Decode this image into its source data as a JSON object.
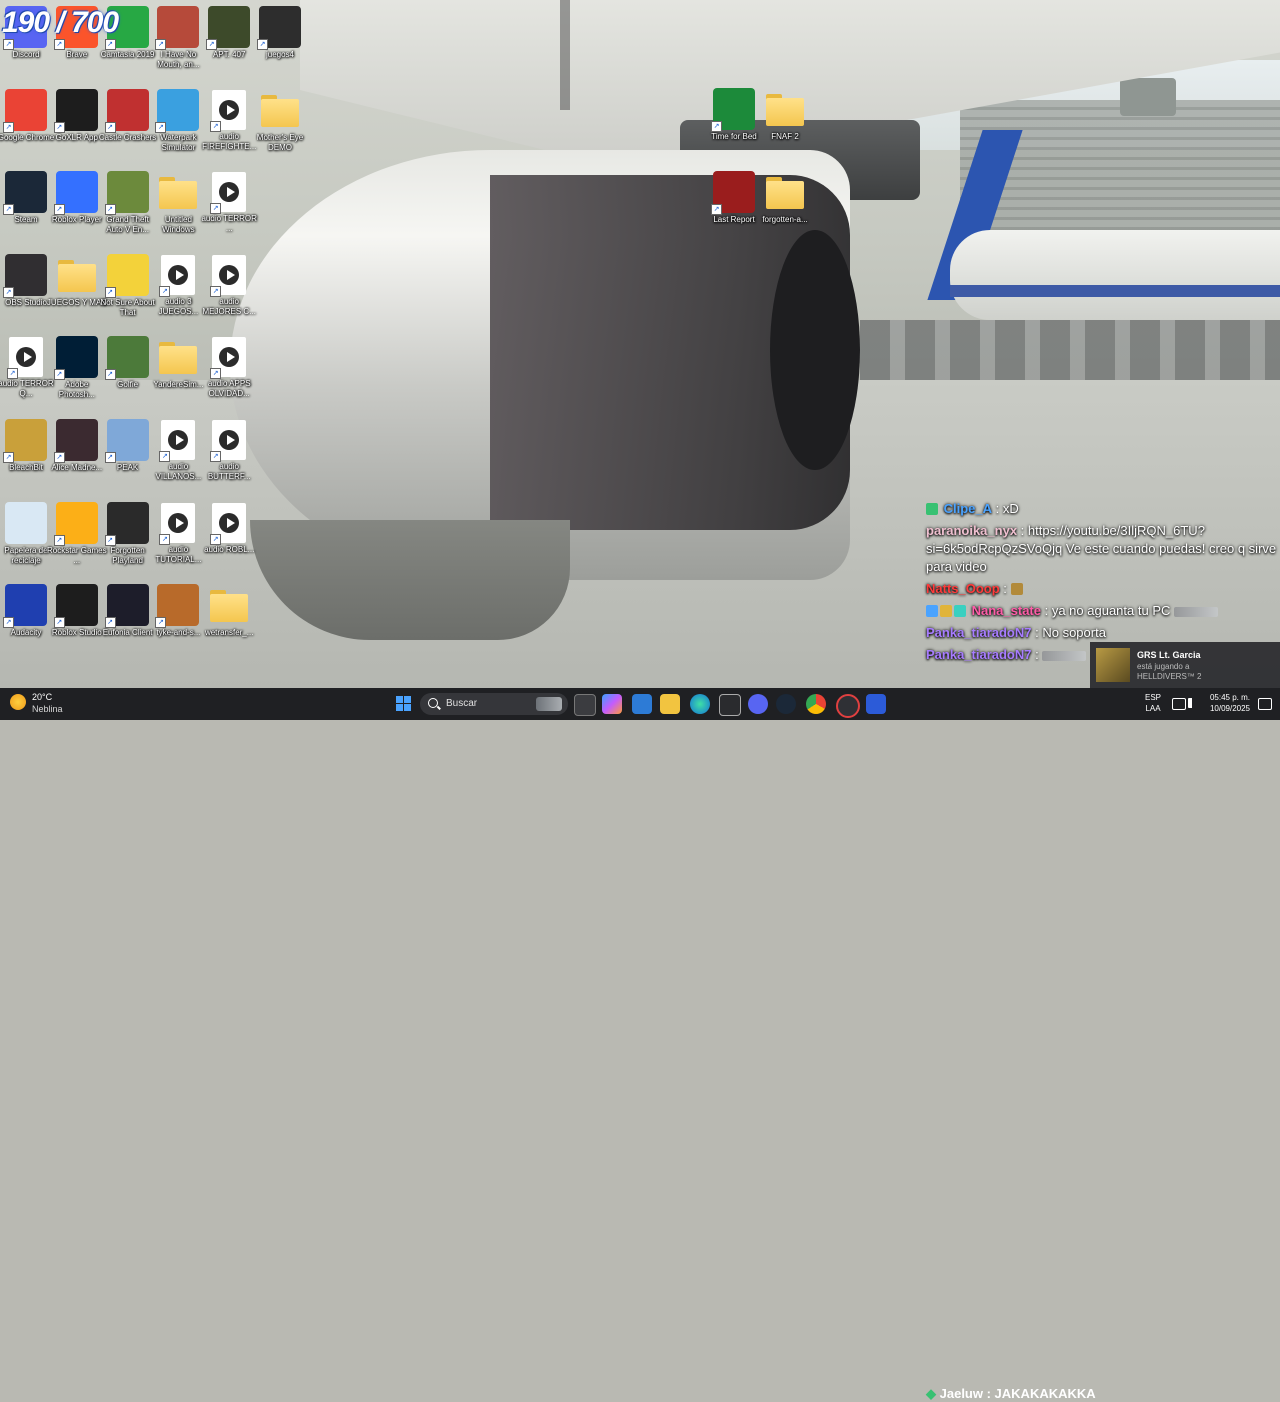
{
  "stream_overlay": {
    "counter_text": "190 / 700"
  },
  "desktop_icons": [
    {
      "id": "discord",
      "label": "Discord",
      "color": "#5865f2"
    },
    {
      "id": "brave",
      "label": "Brave",
      "color": "#fb542b"
    },
    {
      "id": "camtasia",
      "label": "Camtasia 2019",
      "color": "#27a844"
    },
    {
      "id": "ihavenomouth",
      "label": "I Have No Mouth, an...",
      "color": "#b64a3a"
    },
    {
      "id": "apt407",
      "label": "APT. 407",
      "color": "#3d4a2a"
    },
    {
      "id": "juegos4",
      "label": "juegos4",
      "color": "#2d2d2d"
    },
    {
      "id": "chrome",
      "label": "Google Chrome",
      "color": "#ea4335"
    },
    {
      "id": "goxlr",
      "label": "GoXLR App",
      "color": "#1d1d1d"
    },
    {
      "id": "castle",
      "label": "Castle Crashers",
      "color": "#c03030"
    },
    {
      "id": "waterpark",
      "label": "Waterpark Simulator",
      "color": "#3aa0e0"
    },
    {
      "id": "audio_firefighter",
      "label": "audio FIREFIGHTE...",
      "color": "#ffffff"
    },
    {
      "id": "mothers_eye",
      "label": "Mother's Eye DEMO",
      "color": "#f4c64f"
    },
    {
      "id": "steam",
      "label": "Steam",
      "color": "#1b2838"
    },
    {
      "id": "roblox_player",
      "label": "Roblox Player",
      "color": "#3470ff"
    },
    {
      "id": "gta",
      "label": "Grand Theft Auto V En...",
      "color": "#6c8a3c"
    },
    {
      "id": "untitled_windows",
      "label": "Untitled Windows",
      "color": "#f4c64f"
    },
    {
      "id": "audio_terror",
      "label": "audio TERROR ...",
      "color": "#ffffff"
    },
    {
      "id": "obs",
      "label": "OBS Studio",
      "color": "#302e31"
    },
    {
      "id": "juegos_y_mas",
      "label": "JUEGOS Y MAS",
      "color": "#f4c64f"
    },
    {
      "id": "not_sure",
      "label": "Not Sure About That",
      "color": "#f3d23a"
    },
    {
      "id": "audio3_juegos",
      "label": "audio 3 JUEGOS...",
      "color": "#ffffff"
    },
    {
      "id": "audio_mejores",
      "label": "audio MEJORES C...",
      "color": "#ffffff"
    },
    {
      "id": "audio_terror2",
      "label": "audio TERROR Q...",
      "color": "#ffffff"
    },
    {
      "id": "photoshop",
      "label": "Adobe Photosh...",
      "color": "#001e36"
    },
    {
      "id": "golfie",
      "label": "Golfie",
      "color": "#4c7a3a"
    },
    {
      "id": "yandere",
      "label": "YandereSim...",
      "color": "#f4c64f"
    },
    {
      "id": "audio_apps",
      "label": "audio APPS OLVIDAD...",
      "color": "#ffffff"
    },
    {
      "id": "bleachbit",
      "label": "BleachBit",
      "color": "#c9a03a"
    },
    {
      "id": "alice",
      "label": "Alice Madne...",
      "color": "#3b2a30"
    },
    {
      "id": "peak",
      "label": "PEAK",
      "color": "#7fa8d8"
    },
    {
      "id": "audio_villanos",
      "label": "audio VILLANOS...",
      "color": "#ffffff"
    },
    {
      "id": "audio_butterf",
      "label": "audio BUTTERF...",
      "color": "#ffffff"
    },
    {
      "id": "recycle",
      "label": "Papelera de reciclaje",
      "color": "#d9e8f4"
    },
    {
      "id": "rockstar",
      "label": "Rockstar Games ...",
      "color": "#fcaf17"
    },
    {
      "id": "epic",
      "label": "Forgotten Playland",
      "color": "#2a2a2a"
    },
    {
      "id": "audio_tutorial",
      "label": "audio TUTORIAL...",
      "color": "#ffffff"
    },
    {
      "id": "audio_robl",
      "label": "audio ROBL...",
      "color": "#ffffff"
    },
    {
      "id": "audacity",
      "label": "Audacity",
      "color": "#1f3fb0"
    },
    {
      "id": "roblox_studio",
      "label": "Roblox Studio",
      "color": "#1d1d1d"
    },
    {
      "id": "eufonia",
      "label": "Eufonia Client",
      "color": "#1d1d2a"
    },
    {
      "id": "tyke",
      "label": "tyke-and-s...",
      "color": "#b86a2a"
    },
    {
      "id": "wetransfer",
      "label": "wetransfer_...",
      "color": "#f4c64f"
    },
    {
      "id": "time_for_bed",
      "label": "Time for Bed",
      "color": "#1c8a3a"
    },
    {
      "id": "fnaf2",
      "label": "FNAF 2",
      "color": "#f4c64f"
    },
    {
      "id": "last_report",
      "label": "Last Report",
      "color": "#9a1d1d"
    },
    {
      "id": "forgotten_a",
      "label": "forgotten-a...",
      "color": "#f4c64f"
    }
  ],
  "chat": {
    "messages": [
      {
        "user": "Clipe_A",
        "color": "#4aa3ff",
        "text": "xD"
      },
      {
        "user": "paranoika_nyx",
        "color": "#f0c0d0",
        "text": "https://youtu.be/3IljRQN_6TU?si=6k5odRcpQzSVoQjq Ve este cuando puedas! creo q sirve para video"
      },
      {
        "user": "Natts_Ooop",
        "color": "#ff3b3b",
        "text": ""
      },
      {
        "user": "Nana_state",
        "color": "#ff5ca8",
        "text": "ya no aguanta tu PC"
      },
      {
        "user": "Panka_tiaradoN7",
        "color": "#a77cff",
        "text": "No soporta"
      },
      {
        "user": "Panka_tiaradoN7",
        "color": "#a77cff",
        "text": ""
      },
      {
        "user": "Jaeluw",
        "color": "#ffffff",
        "text": "JAKAKAKAKKA"
      }
    ]
  },
  "notification": {
    "name": "GRS Lt. Garcia",
    "status": "está jugando a",
    "game": "HELLDIVERS™ 2"
  },
  "taskbar": {
    "weather_temp": "20°C",
    "weather_desc": "Neblina",
    "search_placeholder": "Buscar",
    "lang_top": "ESP",
    "lang_bottom": "LAA",
    "time": "05:45 p. m.",
    "date": "10/09/2025"
  }
}
